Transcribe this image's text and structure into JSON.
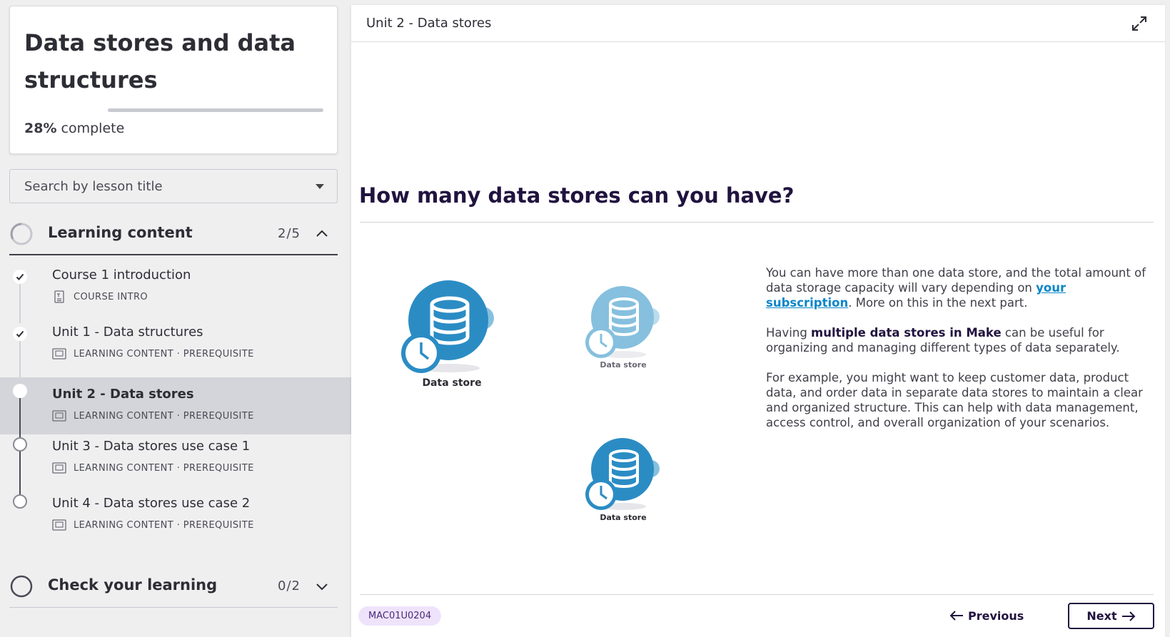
{
  "course": {
    "title": "Data stores and data structures",
    "progress_value": "28%",
    "progress_suffix": "complete",
    "progress_fraction": 0.28
  },
  "search": {
    "placeholder": "Search by lesson title"
  },
  "sections": [
    {
      "title": "Learning content",
      "count": "2/5",
      "expanded": true,
      "lessons": [
        {
          "title": "Course 1 introduction",
          "meta": "COURSE INTRO",
          "status": "completed",
          "icon": "document-icon"
        },
        {
          "title": "Unit 1 - Data structures",
          "meta": "LEARNING CONTENT · PREREQUISITE",
          "status": "completed",
          "icon": "slides-icon"
        },
        {
          "title": "Unit 2 - Data stores",
          "meta": "LEARNING CONTENT · PREREQUISITE",
          "status": "current",
          "icon": "slides-icon"
        },
        {
          "title": "Unit 3 - Data stores use case 1",
          "meta": "LEARNING CONTENT · PREREQUISITE",
          "status": "not-started",
          "icon": "slides-icon"
        },
        {
          "title": "Unit 4 - Data stores use case 2",
          "meta": "LEARNING CONTENT · PREREQUISITE",
          "status": "not-started",
          "icon": "slides-icon"
        }
      ]
    },
    {
      "title": "Check your learning",
      "count": "0/2",
      "expanded": false
    }
  ],
  "main": {
    "header_title": "Unit 2 - Data stores",
    "heading": "How many data stores can you have?",
    "illustration": {
      "labels": [
        "Data store",
        "Data store",
        "Data store"
      ]
    },
    "paragraphs": {
      "p1_before": "You can have more than one data store, and the total amount of data storage capacity will vary depending on ",
      "p1_link": "your subscription",
      "p1_after": ". More on this in the next part.",
      "p2_before": "Having ",
      "p2_strong": "multiple data stores in Make",
      "p2_after": " can be useful for organizing and managing different types of data separately.",
      "p3": "For example, you might want to keep customer data, product data, and order data in separate data stores to maintain a clear and organized structure. This can help with data management, access control, and overall organization of your scenarios."
    },
    "footer": {
      "code": "MAC01U0204",
      "previous_label": "Previous",
      "next_label": "Next"
    }
  },
  "colors": {
    "accent_dark": "#21133f",
    "link": "#0a86c9",
    "data_store_blue": "#2b8cc4",
    "data_store_light": "#86c0de",
    "badge_bg": "#efe3fb"
  }
}
